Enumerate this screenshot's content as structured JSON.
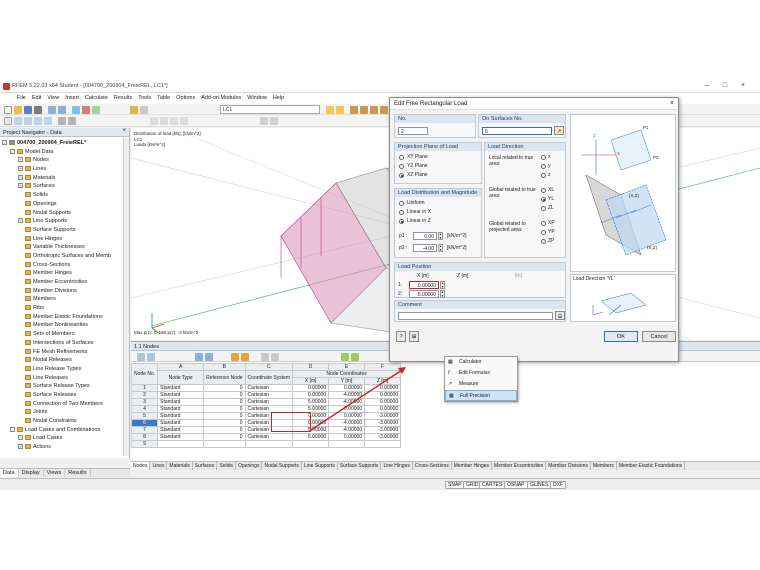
{
  "window": {
    "title": "RFEM 5.22.03 x64 Student - [004700_200904_FreieREL, LC1*]"
  },
  "menu": [
    "File",
    "Edit",
    "View",
    "Insert",
    "Calculate",
    "Results",
    "Tools",
    "Table",
    "Options",
    "Add-on Modules",
    "Window",
    "Help"
  ],
  "toolbar": {
    "load_case": "LC1"
  },
  "navigator": {
    "title": "Project Navigator - Data",
    "project": "004700_200904_FreieREL*",
    "items": [
      {
        "label": "Model Data",
        "level": 1,
        "toggle": "-"
      },
      {
        "label": "Nodes",
        "level": 2,
        "toggle": "+"
      },
      {
        "label": "Lines",
        "level": 2,
        "toggle": "+"
      },
      {
        "label": "Materials",
        "level": 2,
        "toggle": "+"
      },
      {
        "label": "Surfaces",
        "level": 2,
        "toggle": "+"
      },
      {
        "label": "Solids",
        "level": 2,
        "toggle": ""
      },
      {
        "label": "Openings",
        "level": 2,
        "toggle": ""
      },
      {
        "label": "Nodal Supports",
        "level": 2,
        "toggle": ""
      },
      {
        "label": "Line Supports",
        "level": 2,
        "toggle": "+"
      },
      {
        "label": "Surface Supports",
        "level": 2,
        "toggle": ""
      },
      {
        "label": "Line Hinges",
        "level": 2,
        "toggle": ""
      },
      {
        "label": "Variable Thicknesses",
        "level": 2,
        "toggle": ""
      },
      {
        "label": "Orthotropic Surfaces and Memb",
        "level": 2,
        "toggle": ""
      },
      {
        "label": "Cross-Sections",
        "level": 2,
        "toggle": ""
      },
      {
        "label": "Member Hinges",
        "level": 2,
        "toggle": ""
      },
      {
        "label": "Member Eccentricities",
        "level": 2,
        "toggle": ""
      },
      {
        "label": "Member Divisions",
        "level": 2,
        "toggle": ""
      },
      {
        "label": "Members",
        "level": 2,
        "toggle": ""
      },
      {
        "label": "Ribs",
        "level": 2,
        "toggle": ""
      },
      {
        "label": "Member Elastic Foundations",
        "level": 2,
        "toggle": ""
      },
      {
        "label": "Member Nonlinearities",
        "level": 2,
        "toggle": ""
      },
      {
        "label": "Sets of Members",
        "level": 2,
        "toggle": ""
      },
      {
        "label": "Intersections of Surfaces",
        "level": 2,
        "toggle": ""
      },
      {
        "label": "FE Mesh Refinements",
        "level": 2,
        "toggle": ""
      },
      {
        "label": "Nodal Releases",
        "level": 2,
        "toggle": ""
      },
      {
        "label": "Line Release Types",
        "level": 2,
        "toggle": ""
      },
      {
        "label": "Line Releases",
        "level": 2,
        "toggle": ""
      },
      {
        "label": "Surface Release Types",
        "level": 2,
        "toggle": ""
      },
      {
        "label": "Surface Releases",
        "level": 2,
        "toggle": ""
      },
      {
        "label": "Connection of Two Members",
        "level": 2,
        "toggle": ""
      },
      {
        "label": "Joints",
        "level": 2,
        "toggle": ""
      },
      {
        "label": "Nodal Constraints",
        "level": 2,
        "toggle": ""
      },
      {
        "label": "Load Cases and Combinations",
        "level": 1,
        "toggle": "-"
      },
      {
        "label": "Load Cases",
        "level": 2,
        "toggle": "+"
      },
      {
        "label": "Actions",
        "level": 2,
        "toggle": "+"
      }
    ],
    "tabs": [
      "Data",
      "Display",
      "Views",
      "Results"
    ]
  },
  "viewport": {
    "info_lines": [
      "Distribution of load [kN], [kN/m^2]",
      "LC1",
      "Loads [kN/m^2]"
    ],
    "footer": "Max p(z): 0, Min p(z): -3 kN/m^2"
  },
  "table": {
    "title": "1.1 Nodes",
    "col_letters": [
      "A",
      "B",
      "C",
      "D",
      "E",
      "F"
    ],
    "headers": [
      "Node No.",
      "Node Type",
      "Reference Node",
      "Coordinate System",
      "X [m]",
      "Y [m]",
      "Z [m]"
    ],
    "group_header": "Node Coordinates",
    "rows": [
      [
        "1",
        "Standard",
        "0",
        "Cartesian",
        "0.00000",
        "0.00000",
        "0.00000"
      ],
      [
        "2",
        "Standard",
        "0",
        "Cartesian",
        "0.00000",
        "-4.00000",
        "0.00000"
      ],
      [
        "3",
        "Standard",
        "0",
        "Cartesian",
        "5.00000",
        "-4.00000",
        "0.00000"
      ],
      [
        "4",
        "Standard",
        "0",
        "Cartesian",
        "5.00000",
        "0.00000",
        "0.00000"
      ],
      [
        "5",
        "Standard",
        "0",
        "Cartesian",
        "0.00000",
        "0.00000",
        "-3.00000"
      ],
      [
        "6",
        "Standard",
        "0",
        "Cartesian",
        "0.00009",
        "-4.00000",
        "-3.00000"
      ],
      [
        "7",
        "Standard",
        "0",
        "Cartesian",
        "5.00000",
        "-4.00000",
        "-3.00000"
      ],
      [
        "8",
        "Standard",
        "0",
        "Cartesian",
        "5.00000",
        "0.00000",
        "-3.00000"
      ],
      [
        "9",
        "",
        "",
        "",
        "",
        "",
        ""
      ]
    ],
    "tabs": [
      "Nodes",
      "Lines",
      "Materials",
      "Surfaces",
      "Solids",
      "Openings",
      "Nodal Supports",
      "Line Supports",
      "Surface Supports",
      "Line Hinges",
      "Cross-Sections",
      "Member Hinges",
      "Member Eccentricities",
      "Member Divisions",
      "Members",
      "Member Elastic Foundations"
    ]
  },
  "statusbar": [
    "SNAP",
    "GRID",
    "CARTES",
    "OSNAP",
    "GLINES",
    "DXF"
  ],
  "dialog": {
    "title": "Edit Free Rectangular Load",
    "no_label": "No.",
    "no_value": "2",
    "on_surfaces_label": "On Surfaces No.",
    "on_surfaces_value": "6",
    "projection_title": "Projection Plane of Load",
    "projection_options": [
      "XY Plane",
      "YZ Plane",
      "XZ Plane"
    ],
    "direction_title": "Load Direction",
    "local_label": "Local related to true area:",
    "local_options": [
      "x",
      "y",
      "z"
    ],
    "global_label": "Global related to true area:",
    "global_options": [
      "XL",
      "YL",
      "ZL"
    ],
    "global_proj_label": "Global related to projected area:",
    "global_proj_options": [
      "XP",
      "YP",
      "ZP"
    ],
    "distribution_title": "Load Distribution and Magnitude",
    "distribution_options": [
      "Uniform",
      "Linear in X",
      "Linear in Z"
    ],
    "p1_label": "p1 :",
    "p1_value": "0.00",
    "p2_label": "p2 :",
    "p2_value": "-4.00",
    "p_unit": "[kN/m^2]",
    "position_title": "Load Position",
    "x_header": "X [m]",
    "z_header": "Z [m]",
    "z2_header": "[m]",
    "row1_label": "1:",
    "row1_x": "0.00000",
    "row2_label": "2:",
    "row2_x": "5.00000",
    "comment_title": "Comment",
    "ok": "OK",
    "cancel": "Cancel",
    "preview_caption": "Load Direction 'YL'",
    "preview_labels": [
      "P1",
      "P2",
      "X",
      "Z",
      "(X,Z)",
      "(X,Z)"
    ]
  },
  "context_menu": [
    "Calculator",
    "Edit Formulas",
    "Measure",
    "Full Precision"
  ]
}
